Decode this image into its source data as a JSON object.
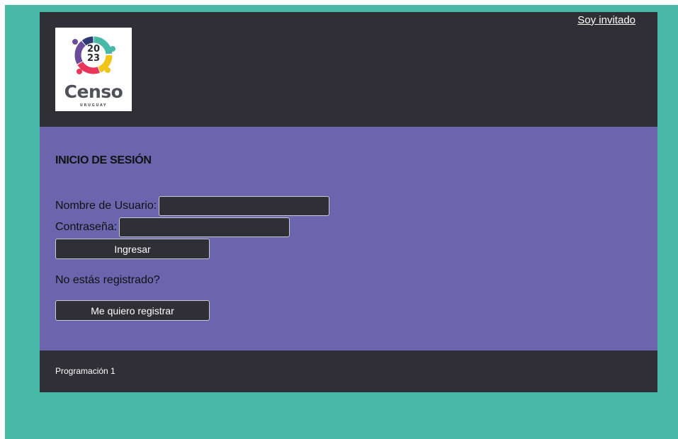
{
  "colors": {
    "viewport_background": "#48b9a7",
    "header_background": "#302f35",
    "main_background": "#6c64ad",
    "footer_background": "#302f35",
    "control_background": "#302f35",
    "control_border": "#c9c9d4"
  },
  "header": {
    "guest_link": "Soy invitado",
    "logo": {
      "year_top": "20",
      "year_bottom": "23",
      "word": "Censo",
      "country": "URUGUAY"
    }
  },
  "login": {
    "title": "INICIO DE SESIÓN",
    "username_label": "Nombre de Usuario:",
    "username_value": "",
    "password_label": "Contraseña:",
    "password_value": "",
    "submit_label": "Ingresar",
    "register_prompt": "No estás registrado?",
    "register_label": "Me quiero registrar"
  },
  "footer": {
    "text": "Programación 1"
  }
}
